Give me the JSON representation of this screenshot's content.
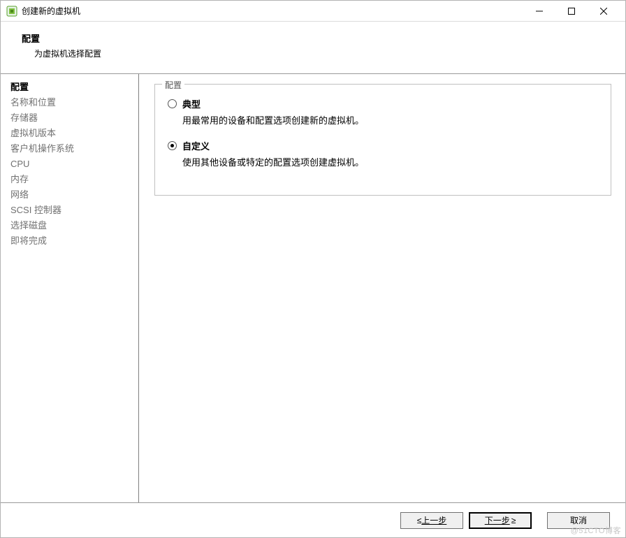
{
  "window": {
    "title": "创建新的虚拟机"
  },
  "header": {
    "title": "配置",
    "subtitle": "为虚拟机选择配置"
  },
  "sidebar": {
    "steps": [
      {
        "label": "配置",
        "current": true
      },
      {
        "label": "名称和位置",
        "current": false
      },
      {
        "label": "存储器",
        "current": false
      },
      {
        "label": "虚拟机版本",
        "current": false
      },
      {
        "label": "客户机操作系统",
        "current": false
      },
      {
        "label": "CPU",
        "current": false
      },
      {
        "label": "内存",
        "current": false
      },
      {
        "label": "网络",
        "current": false
      },
      {
        "label": "SCSI 控制器",
        "current": false
      },
      {
        "label": "选择磁盘",
        "current": false
      },
      {
        "label": "即将完成",
        "current": false
      }
    ]
  },
  "main": {
    "group_label": "配置",
    "options": [
      {
        "label": "典型",
        "description": "用最常用的设备和配置选项创建新的虚拟机。",
        "selected": false
      },
      {
        "label": "自定义",
        "description": "使用其他设备或特定的配置选项创建虚拟机。",
        "selected": true
      }
    ]
  },
  "buttons": {
    "back_prefix": "≤",
    "back_label": "上一步",
    "next_label": "下一步",
    "next_suffix": "≥",
    "cancel_label": "取消"
  },
  "watermark": "@51CTO博客"
}
